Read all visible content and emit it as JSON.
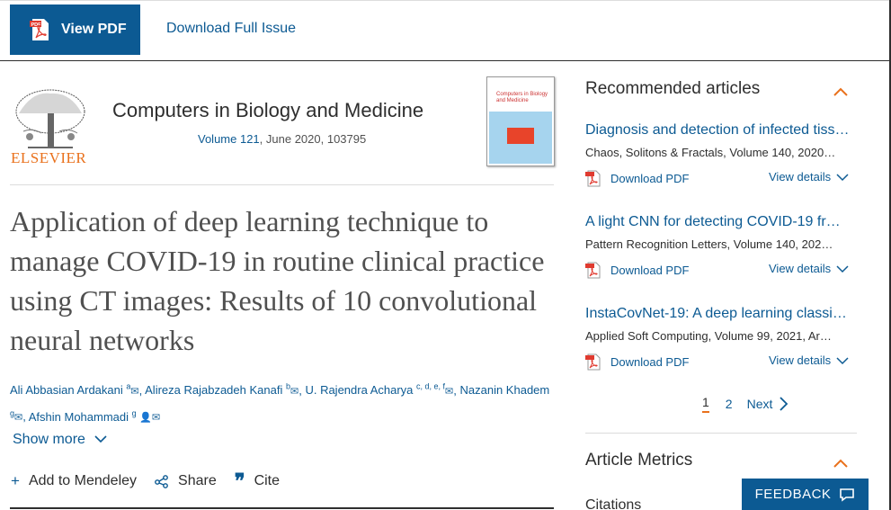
{
  "toolbar": {
    "view_pdf_label": "View PDF",
    "download_issue_label": "Download Full Issue"
  },
  "journal": {
    "publisher": "ELSEVIER",
    "title": "Computers in Biology and Medicine",
    "volume_link": "Volume 121",
    "issue_rest": ", June 2020, 103795",
    "cover_title": "Computers in Biology and Medicine"
  },
  "article": {
    "title": "Application of deep learning technique to manage COVID-19 in routine clinical practice using CT images: Results of 10 convolutional neural networks",
    "authors": [
      {
        "name": "Ali Abbasian Ardakani",
        "sup": "a"
      },
      {
        "name": "Alireza Rajabzadeh Kanafi",
        "sup": "b"
      },
      {
        "name": "U. Rajendra Acharya",
        "sup": "c, d, e, f"
      },
      {
        "name": "Nazanin Khadem",
        "sup": "g"
      },
      {
        "name": "Afshin Mohammadi",
        "sup": "g"
      }
    ],
    "show_more": "Show more",
    "actions": {
      "mendeley": "Add to Mendeley",
      "share": "Share",
      "cite": "Cite"
    }
  },
  "sidebar": {
    "recommended_heading": "Recommended articles",
    "items": [
      {
        "title": "Diagnosis and detection of infected tiss…",
        "source": "Chaos, Solitons & Fractals, Volume 140, 2020…",
        "download": "Download PDF",
        "details": "View details"
      },
      {
        "title": "A light CNN for detecting COVID-19 fr…",
        "source": "Pattern Recognition Letters, Volume 140, 202…",
        "download": "Download PDF",
        "details": "View details"
      },
      {
        "title": "InstaCovNet-19: A deep learning classi…",
        "source": "Applied Soft Computing, Volume 99, 2021, Ar…",
        "download": "Download PDF",
        "details": "View details"
      }
    ],
    "pager": {
      "page1": "1",
      "page2": "2",
      "next": "Next"
    },
    "metrics_heading": "Article Metrics",
    "citations_label": "Citations"
  },
  "feedback_label": "FEEDBACK",
  "colors": {
    "brand_blue": "#0c5a93",
    "accent_orange": "#e9711c"
  }
}
